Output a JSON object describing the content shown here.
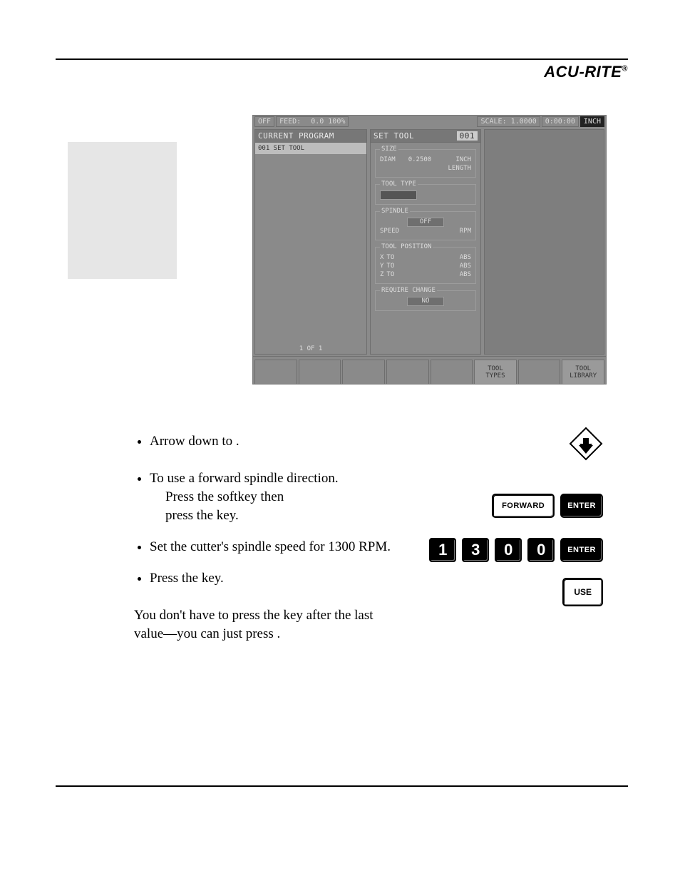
{
  "brand": "ACU-RITE",
  "screenshot": {
    "status": {
      "mode": "OFF",
      "feed_label": "FEED:",
      "feed_value": "0.0 100%",
      "scale_label": "SCALE:",
      "scale_value": "1.0000",
      "time": "0:00:00",
      "units": "INCH"
    },
    "left_panel": {
      "title": "CURRENT PROGRAM",
      "line1": "001  SET TOOL",
      "pager": "1 OF 1"
    },
    "mid_panel": {
      "title": "SET TOOL",
      "step_num": "001",
      "size": {
        "legend": "SIZE",
        "diam_label": "DIAM",
        "diam_value": "0.2500",
        "diam_units": "INCH",
        "length_label": "LENGTH"
      },
      "tool_type": {
        "legend": "TOOL TYPE"
      },
      "spindle": {
        "legend": "SPINDLE",
        "dir_value": "OFF",
        "speed_label": "SPEED",
        "speed_units": "RPM"
      },
      "toolpos": {
        "legend": "TOOL POSITION",
        "rows": [
          {
            "axis": "X",
            "to": "TO",
            "mode": "ABS"
          },
          {
            "axis": "Y",
            "to": "TO",
            "mode": "ABS"
          },
          {
            "axis": "Z",
            "to": "TO",
            "mode": "ABS"
          }
        ]
      },
      "reqchange": {
        "legend": "REQUIRE CHANGE",
        "value": "NO"
      }
    },
    "softkeys": {
      "types": "TOOL\nTYPES",
      "library": "TOOL\nLIBRARY"
    }
  },
  "instructions": {
    "i1_a": "Arrow down to ",
    "i1_b": ".",
    "i2_a": "To use a forward spindle direction.",
    "i2_b1": "Press the ",
    "i2_b2": " softkey then",
    "i2_c1": "press the ",
    "i2_c2": " key.",
    "i3": "Set the cutter's spindle speed for 1300 RPM.",
    "i4_a": "Press the ",
    "i4_b": " key.",
    "p1_a": "You don't have to press the ",
    "p1_b": " key after the last",
    "p2_a": "value—you can just press ",
    "p2_b": "."
  },
  "keys": {
    "forward": "FORWARD",
    "enter": "ENTER",
    "digits": [
      "1",
      "3",
      "0",
      "0"
    ],
    "use": "USE"
  }
}
